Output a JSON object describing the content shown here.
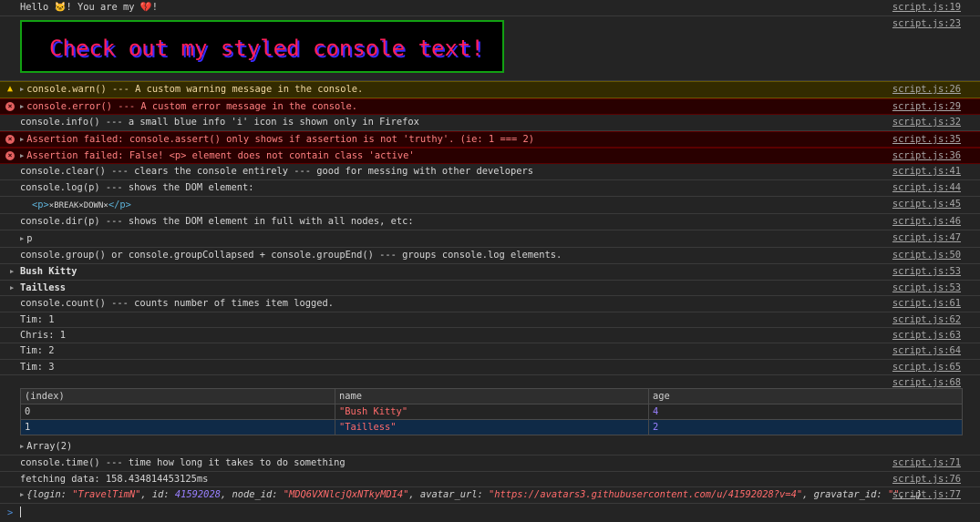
{
  "lines": {
    "hello": {
      "text": "Hello 🐱! You are my 💔!",
      "src": "script.js:19"
    },
    "styled": {
      "text": "Check out my styled console text!",
      "src": "script.js:23"
    },
    "warn": {
      "text": "console.warn() --- A custom warning message in the console.",
      "src": "script.js:26"
    },
    "error": {
      "text": "console.error() --- A custom error message in the console.",
      "src": "script.js:29"
    },
    "info": {
      "text": "console.info() --- a small blue info 'i' icon is shown only in Firefox",
      "src": "script.js:32"
    },
    "assert1": {
      "text": "Assertion failed: console.assert() only shows if assertion is not 'truthy'. (ie: 1 === 2)",
      "src": "script.js:35"
    },
    "assert2": {
      "text": "Assertion failed: False! <p> element does not contain class 'active'",
      "src": "script.js:36"
    },
    "clear": {
      "text": "console.clear() --- clears the console entirely --- good for messing with other developers",
      "src": "script.js:41"
    },
    "log_p": {
      "text": "console.log(p) --- shows the DOM element:",
      "src": "script.js:44"
    },
    "dom_el": {
      "open": "<p>",
      "content": "×BREAK×DOWN×",
      "close": "</p>",
      "src": "script.js:45"
    },
    "dir_p": {
      "text": "console.dir(p) --- shows the DOM element in full with all nodes, etc:",
      "src": "script.js:46"
    },
    "p_obj": {
      "text": "p",
      "src": "script.js:47"
    },
    "group": {
      "text": "console.group() or console.groupCollapsed + console.groupEnd() --- groups console.log elements.",
      "src": "script.js:50"
    },
    "bush": {
      "text": "Bush Kitty",
      "src": "script.js:53"
    },
    "tailless": {
      "text": "Tailless",
      "src": "script.js:53"
    },
    "count": {
      "text": "console.count() --- counts number of times item logged.",
      "src": "script.js:61"
    },
    "tim1": {
      "text": "Tim: 1",
      "src": "script.js:62"
    },
    "chris1": {
      "text": "Chris: 1",
      "src": "script.js:63"
    },
    "tim2": {
      "text": "Tim: 2",
      "src": "script.js:64"
    },
    "tim3": {
      "text": "Tim: 3",
      "src": "script.js:65"
    },
    "table": {
      "src": "script.js:68",
      "headers": [
        "(index)",
        "name",
        "age"
      ],
      "rows": [
        {
          "index": "0",
          "name": "\"Bush Kitty\"",
          "age": "4"
        },
        {
          "index": "1",
          "name": "\"Tailless\"",
          "age": "2"
        }
      ],
      "array_label": "Array(2)"
    },
    "time": {
      "text": "console.time() --- time how long it takes to do something",
      "src": "script.js:71"
    },
    "fetching": {
      "text": "fetching data: 158.434814453125ms",
      "src": "script.js:76"
    },
    "obj": {
      "src": "script.js:77",
      "open": "{",
      "k1": "login: ",
      "v1": "\"TravelTimN\"",
      "k2": ", id: ",
      "v2": "41592028",
      "k3": ", node_id: ",
      "v3": "\"MDQ6VXNlcjQxNTkyMDI4\"",
      "k4": ", avatar_url: ",
      "v4": "\"https://avatars3.githubusercontent.com/u/41592028?v=4\"",
      "k5": ", gravatar_id: ",
      "v5": "\"\"",
      "tail": ", …}"
    }
  },
  "prompt": {
    "symbol": ">"
  },
  "colors": {
    "warn_bg": "#332b00",
    "error_bg": "#290000",
    "styled_text": "#ff1f5a",
    "styled_border": "#12a112",
    "table_selected": "#0f2a47"
  }
}
